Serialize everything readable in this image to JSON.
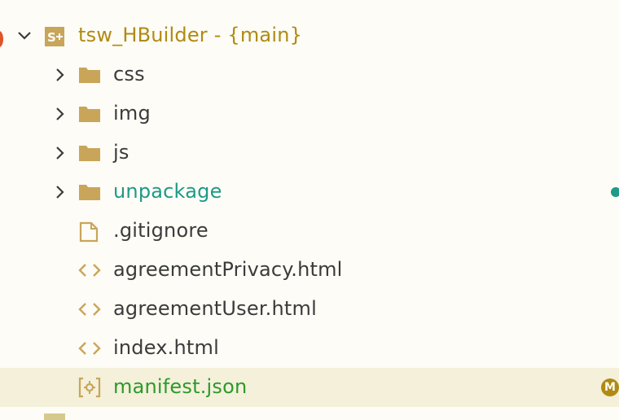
{
  "explorer": {
    "root": {
      "label": "tsw_HBuilder - {main}",
      "icon": "uniapp-project-icon",
      "expanded": true
    },
    "items": [
      {
        "label": "css",
        "type": "folder",
        "icon": "folder-icon",
        "chevron": "chevron-right-icon"
      },
      {
        "label": "img",
        "type": "folder",
        "icon": "folder-icon",
        "chevron": "chevron-right-icon"
      },
      {
        "label": "js",
        "type": "folder",
        "icon": "folder-icon",
        "chevron": "chevron-right-icon"
      },
      {
        "label": "unpackage",
        "type": "folder",
        "icon": "folder-icon",
        "chevron": "chevron-right-icon",
        "status": "untracked-dot",
        "status_color": "#1e9a86"
      },
      {
        "label": ".gitignore",
        "type": "file",
        "icon": "file-icon"
      },
      {
        "label": "agreementPrivacy.html",
        "type": "file",
        "icon": "code-brackets-icon"
      },
      {
        "label": "agreementUser.html",
        "type": "file",
        "icon": "code-brackets-icon"
      },
      {
        "label": "index.html",
        "type": "file",
        "icon": "code-brackets-icon"
      },
      {
        "label": "manifest.json",
        "type": "file",
        "icon": "manifest-icon",
        "selected": true,
        "status_badge": "M",
        "status_color": "#b08a12"
      }
    ]
  },
  "colors": {
    "background": "#fdfcf6",
    "selection": "#f4f0da",
    "accent_gold": "#b08a12",
    "folder": "#c9a55a",
    "text": "#3b3b3b",
    "teal": "#1e9a86",
    "green": "#2c9a2c"
  }
}
